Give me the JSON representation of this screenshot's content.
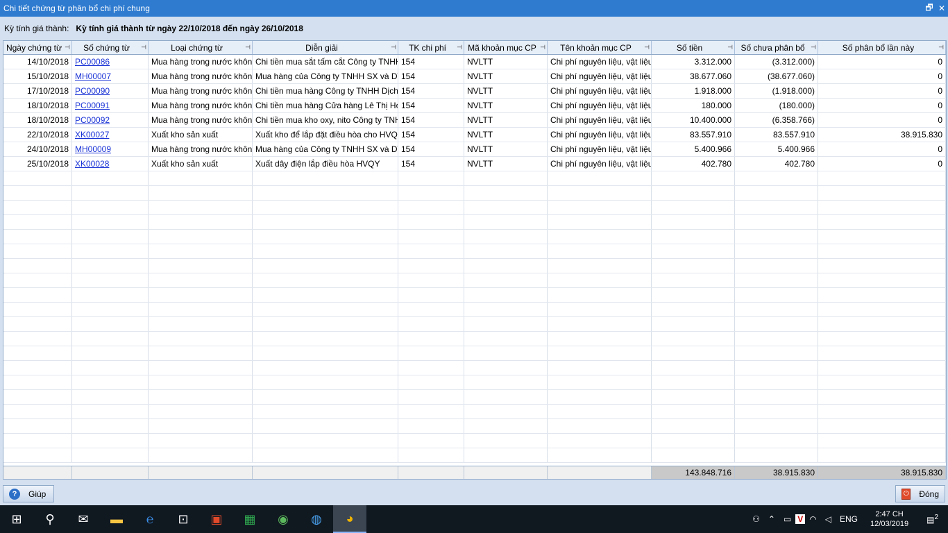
{
  "window": {
    "title": "Chi tiết chứng từ phân bổ chi phí chung",
    "restore_glyph": "🗗",
    "close_glyph": "✕"
  },
  "info": {
    "label": "Kỳ tính giá thành:",
    "value": "Kỳ tính giá thành từ ngày 22/10/2018 đến ngày 26/10/2018"
  },
  "columns": [
    "Ngày chứng từ",
    "Số chứng từ",
    "Loại chứng từ",
    "Diễn giải",
    "TK chi phí",
    "Mã khoản mục CP",
    "Tên khoản mục CP",
    "Số tiền",
    "Số chưa phân bổ",
    "Số phân bổ lần này"
  ],
  "rows": [
    {
      "date": "14/10/2018",
      "doc_no": "PC00086",
      "doc_type": "Mua hàng trong nước không",
      "desc": "Chi tiền mua sắt tấm cắt  Công ty TNHH",
      "account": "154",
      "cost_code": "NVLTT",
      "cost_name": "Chi phí nguyên liệu, vật liệu",
      "amount": "3.312.000",
      "unallocated": "(3.312.000)",
      "allocated": "0"
    },
    {
      "date": "15/10/2018",
      "doc_no": "MH00007",
      "doc_type": "Mua hàng trong nước không",
      "desc": "Mua hàng của Công ty TNHH SX và DV",
      "account": "154",
      "cost_code": "NVLTT",
      "cost_name": "Chi phí nguyên liệu, vật liệu",
      "amount": "38.677.060",
      "unallocated": "(38.677.060)",
      "allocated": "0"
    },
    {
      "date": "17/10/2018",
      "doc_no": "PC00090",
      "doc_type": "Mua hàng trong nước không",
      "desc": "Chi tiền mua hàng Công ty TNHH Dịch",
      "account": "154",
      "cost_code": "NVLTT",
      "cost_name": "Chi phí nguyên liệu, vật liệu",
      "amount": "1.918.000",
      "unallocated": "(1.918.000)",
      "allocated": "0"
    },
    {
      "date": "18/10/2018",
      "doc_no": "PC00091",
      "doc_type": "Mua hàng trong nước không",
      "desc": "Chi tiền mua hàng Cửa hàng Lê Thị Ho",
      "account": "154",
      "cost_code": "NVLTT",
      "cost_name": "Chi phí nguyên liệu, vật liệu",
      "amount": "180.000",
      "unallocated": "(180.000)",
      "allocated": "0"
    },
    {
      "date": "18/10/2018",
      "doc_no": "PC00092",
      "doc_type": "Mua hàng trong nước không",
      "desc": "Chi tiền mua kho oxy, nito Công ty TNH",
      "account": "154",
      "cost_code": "NVLTT",
      "cost_name": "Chi phí nguyên liệu, vật liệu",
      "amount": "10.400.000",
      "unallocated": "(6.358.766)",
      "allocated": "0"
    },
    {
      "date": "22/10/2018",
      "doc_no": "XK00027",
      "doc_type": "Xuất kho sản xuất",
      "desc": "Xuất kho để lắp đặt điều hòa cho HVQY",
      "account": "154",
      "cost_code": "NVLTT",
      "cost_name": "Chi phí nguyên liệu, vật liệu",
      "amount": "83.557.910",
      "unallocated": "83.557.910",
      "allocated": "38.915.830"
    },
    {
      "date": "24/10/2018",
      "doc_no": "MH00009",
      "doc_type": "Mua hàng trong nước không",
      "desc": "Mua hàng của Công ty TNHH SX và DV",
      "account": "154",
      "cost_code": "NVLTT",
      "cost_name": "Chi phí nguyên liệu, vật liệu",
      "amount": "5.400.966",
      "unallocated": "5.400.966",
      "allocated": "0"
    },
    {
      "date": "25/10/2018",
      "doc_no": "XK00028",
      "doc_type": "Xuất kho sản xuất",
      "desc": "Xuất dây điện lắp điều hòa HVQY",
      "account": "154",
      "cost_code": "NVLTT",
      "cost_name": "Chi phí nguyên liệu, vật liệu",
      "amount": "402.780",
      "unallocated": "402.780",
      "allocated": "0"
    }
  ],
  "totals": {
    "amount": "143.848.716",
    "unallocated": "38.915.830",
    "allocated": "38.915.830"
  },
  "buttons": {
    "help": "Giúp",
    "close": "Đóng"
  },
  "taskbar": {
    "lang": "ENG",
    "time": "2:47 CH",
    "date": "12/03/2019",
    "notifications": "2"
  }
}
